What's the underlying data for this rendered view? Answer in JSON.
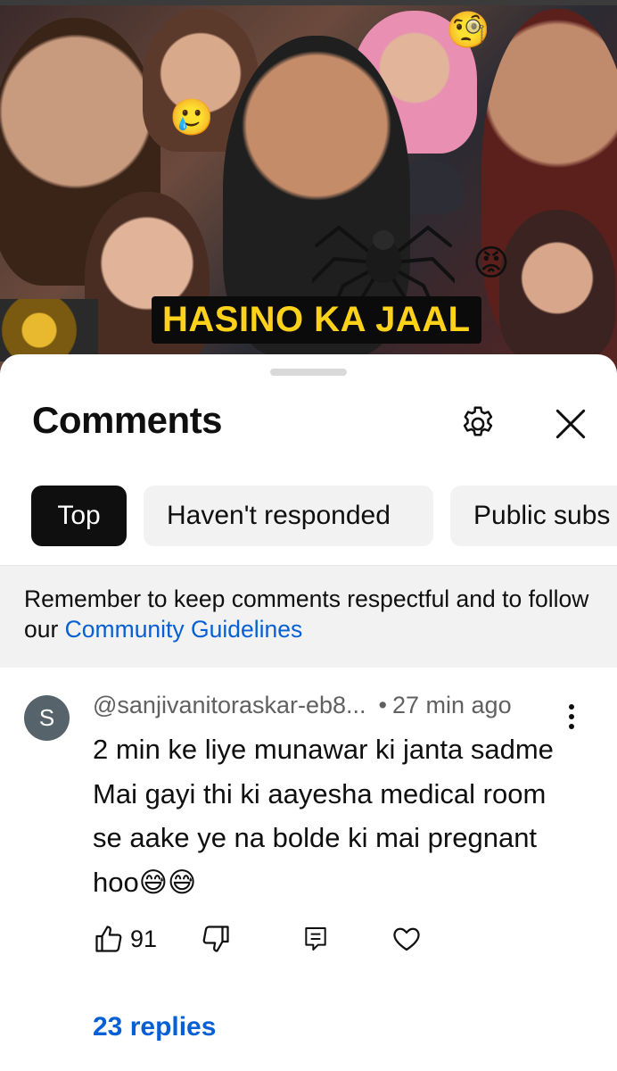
{
  "thumbnail": {
    "title_text": "HASINO KA JAAL",
    "emojis": [
      "🥲",
      "🧐",
      "😡"
    ]
  },
  "comments_sheet": {
    "title": "Comments",
    "icons": {
      "settings": "gear-icon",
      "close": "close-icon"
    },
    "filters": [
      "Top",
      "Haven't responded",
      "Public subs"
    ],
    "active_filter": "Top",
    "notice": {
      "text": "Remember to keep comments respectful and to follow our ",
      "link": "Community Guidelines"
    }
  },
  "comment": {
    "avatar_letter": "S",
    "author": "@sanjivanitoraskar-eb8...",
    "time": "27 min ago",
    "text": "2 min ke liye munawar ki janta sadme Mai gayi thi ki aayesha medical room se aake ye na bolde ki mai pregnant hoo😅😅",
    "likes": "91",
    "replies_label": "23 replies"
  },
  "colors": {
    "link_blue": "#065fd4",
    "chip_active_bg": "#0f0f0f",
    "chip_bg": "#f2f2f2",
    "notice_bg": "#f2f2f2",
    "avatar_bg": "#57636b"
  }
}
